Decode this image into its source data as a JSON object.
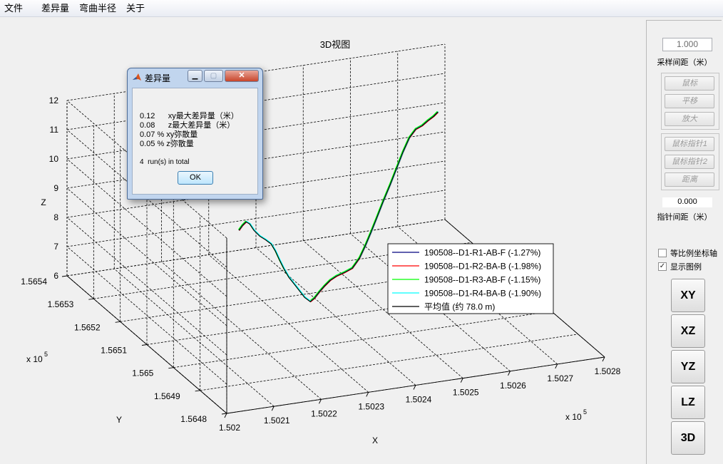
{
  "menu": [
    "文件",
    "差异量",
    "弯曲半径",
    "关于"
  ],
  "plot": {
    "title": "3D视图",
    "xlabel": "X",
    "ylabel": "Y",
    "zlabel": "Z",
    "x_ticks": [
      "1.502",
      "1.5021",
      "1.5022",
      "1.5023",
      "1.5024",
      "1.5025",
      "1.5026",
      "1.5027",
      "1.5028"
    ],
    "x_exponent": "x 10",
    "x_exponent_power": "5",
    "y_ticks": [
      "1.5648",
      "1.5649",
      "1.565",
      "1.5651",
      "1.5652",
      "1.5653",
      "1.5654"
    ],
    "y_exponent": "x 10",
    "y_exponent_power": "5",
    "z_ticks": [
      "6",
      "7",
      "8",
      "9",
      "10",
      "11",
      "12"
    ],
    "legend": [
      {
        "label": "190508--D1-R1-AB-F (-1.27%)",
        "color": "#00007f"
      },
      {
        "label": "190508--D1-R2-BA-B (-1.98%)",
        "color": "#ff0000"
      },
      {
        "label": "190508--D1-R3-AB-F (-1.15%)",
        "color": "#00ff00"
      },
      {
        "label": "190508--D1-R4-BA-B (-1.90%)",
        "color": "#00ffff"
      },
      {
        "label": "平均值 (约 78.0 m)",
        "color": "#000000"
      }
    ]
  },
  "panel": {
    "sample_spacing_value": "1.000",
    "sample_spacing_label": "采样间距（米）",
    "group1": [
      "鼠标",
      "平移",
      "放大"
    ],
    "group2": [
      "鼠标指针1",
      "鼠标指针2",
      "距离"
    ],
    "pointer_spacing_value": "0.000",
    "pointer_spacing_label": "指针间距（米）",
    "equal_axes": {
      "label": "等比例坐标轴",
      "checked": false
    },
    "show_legend": {
      "label": "显示图例",
      "checked": true
    },
    "view_buttons": [
      "XY",
      "XZ",
      "YZ",
      "LZ",
      "3D"
    ]
  },
  "dialog": {
    "title": "差异量",
    "lines": [
      "0.12      xy最大差异量（米）",
      "0.08      z最大差异量（米）",
      "0.07 % xy弥散量",
      "0.05 % z弥散量",
      "4  run(s) in total"
    ],
    "ok": "OK"
  }
}
